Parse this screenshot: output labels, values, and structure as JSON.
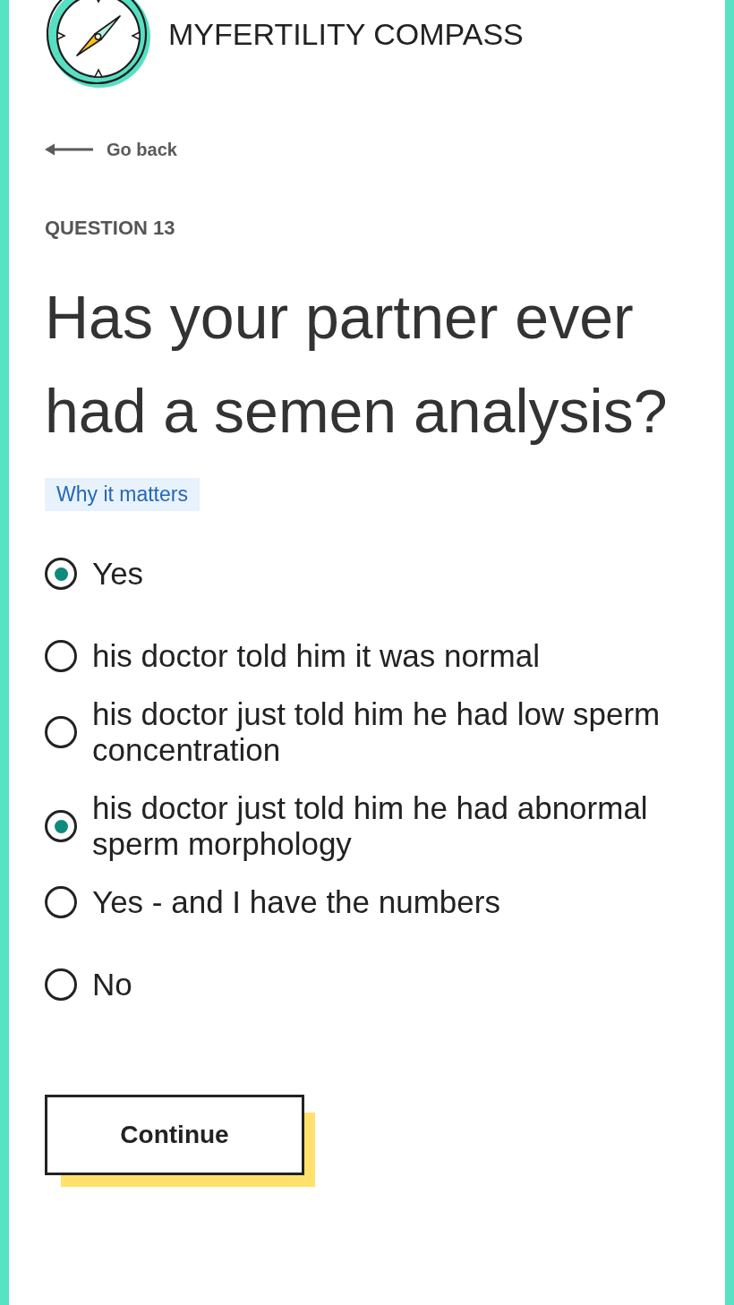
{
  "header": {
    "title": "MYFERTILITY COMPASS"
  },
  "back_link": {
    "label": "Go back"
  },
  "question": {
    "number_label": "QUESTION 13",
    "text": "Has your partner ever had a semen analysis?",
    "help_link": "Why it matters"
  },
  "options": [
    {
      "label": "Yes",
      "selected": true,
      "children": [
        {
          "label": "his doctor told him it was normal",
          "selected": false
        },
        {
          "label": "his doctor just told him he had low sperm concentration",
          "selected": false
        },
        {
          "label": "his doctor just told him he had abnormal sperm morphology",
          "selected": true
        },
        {
          "label": "Yes - and I have the numbers",
          "selected": false
        }
      ]
    },
    {
      "label": "No",
      "selected": false
    }
  ],
  "continue_button": {
    "label": "Continue"
  }
}
